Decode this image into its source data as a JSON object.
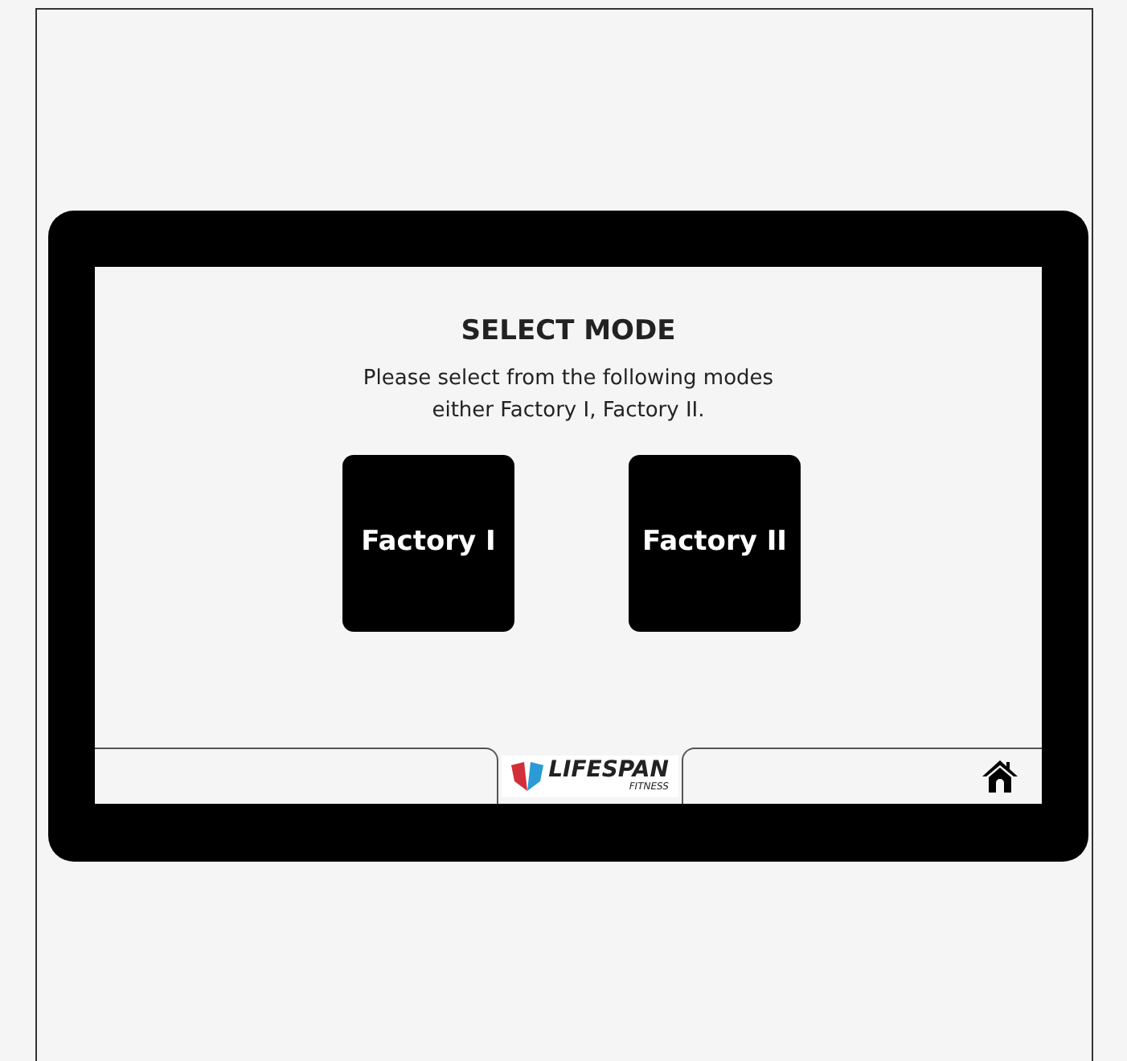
{
  "title": "SELECT MODE",
  "message_lines": [
    "Please select from the following modes",
    "either Factory I, Factory II."
  ],
  "modes": [
    {
      "label": "Factory I"
    },
    {
      "label": "Factory II"
    }
  ],
  "footer": {
    "logo": {
      "name": "LIFESPAN",
      "tagline": "FITNESS"
    }
  }
}
